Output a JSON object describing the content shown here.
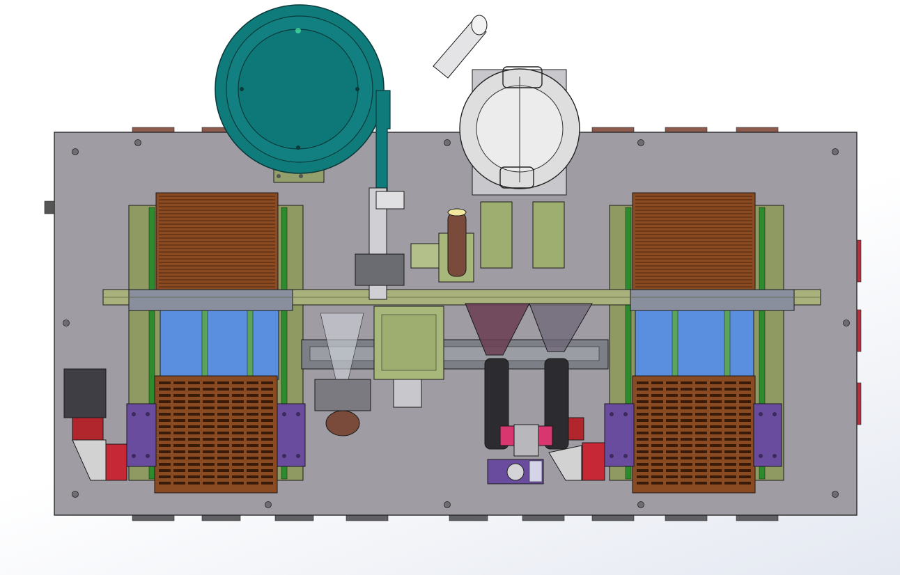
{
  "model": {
    "components": [
      "base-plate",
      "vibratory-bowl-feeder",
      "reel-holder",
      "left-heatsink-cassette",
      "right-heatsink-cassette",
      "crossbar-rail",
      "central-slide-assembly",
      "dispenser-heads",
      "drive-motor-left",
      "drive-motor-right"
    ]
  },
  "colors": {
    "background": "#ffffff",
    "plate": "#a09ca3",
    "bowl": "#0f7b7b",
    "copper": "#8a4b23",
    "frame_green": "#9aa86c",
    "window_blue": "#5a8fe0",
    "bracket_purple": "#6a4c9e",
    "rail": "#8a8f9e",
    "accent_red": "#c62836",
    "accent_pink": "#d8366e"
  }
}
